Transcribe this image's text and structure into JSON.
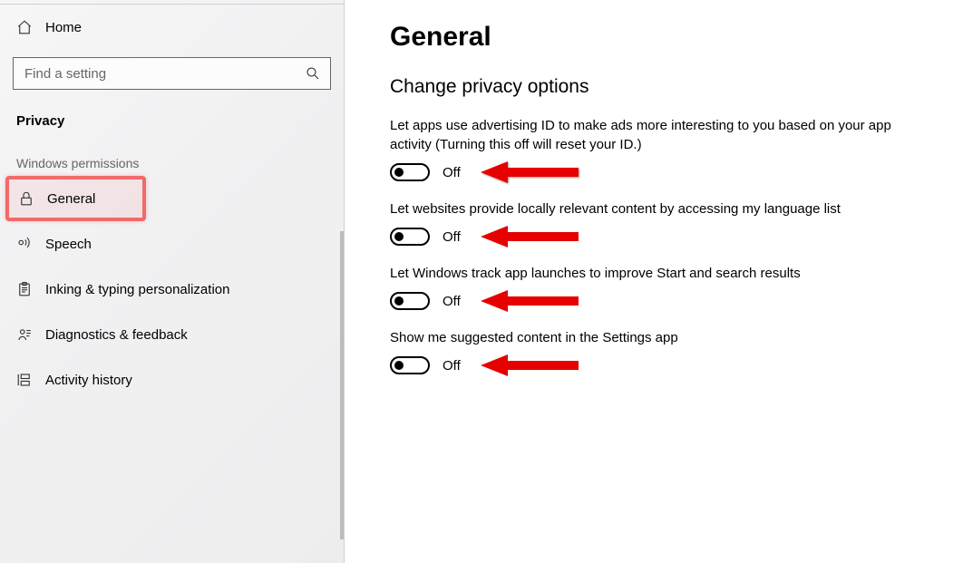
{
  "sidebar": {
    "home": "Home",
    "search_placeholder": "Find a setting",
    "category": "Privacy",
    "group": "Windows permissions",
    "items": [
      {
        "label": "General"
      },
      {
        "label": "Speech"
      },
      {
        "label": "Inking & typing personalization"
      },
      {
        "label": "Diagnostics & feedback"
      },
      {
        "label": "Activity history"
      }
    ]
  },
  "page": {
    "title": "General",
    "subtitle": "Change privacy options",
    "settings": [
      {
        "desc": "Let apps use advertising ID to make ads more interesting to you based on your app activity (Turning this off will reset your ID.)",
        "state": "Off"
      },
      {
        "desc": "Let websites provide locally relevant content by accessing my language list",
        "state": "Off"
      },
      {
        "desc": "Let Windows track app launches to improve Start and search results",
        "state": "Off"
      },
      {
        "desc": "Show me suggested content in the Settings app",
        "state": "Off"
      }
    ]
  },
  "annotation": {
    "arrow_color": "#e60000"
  }
}
